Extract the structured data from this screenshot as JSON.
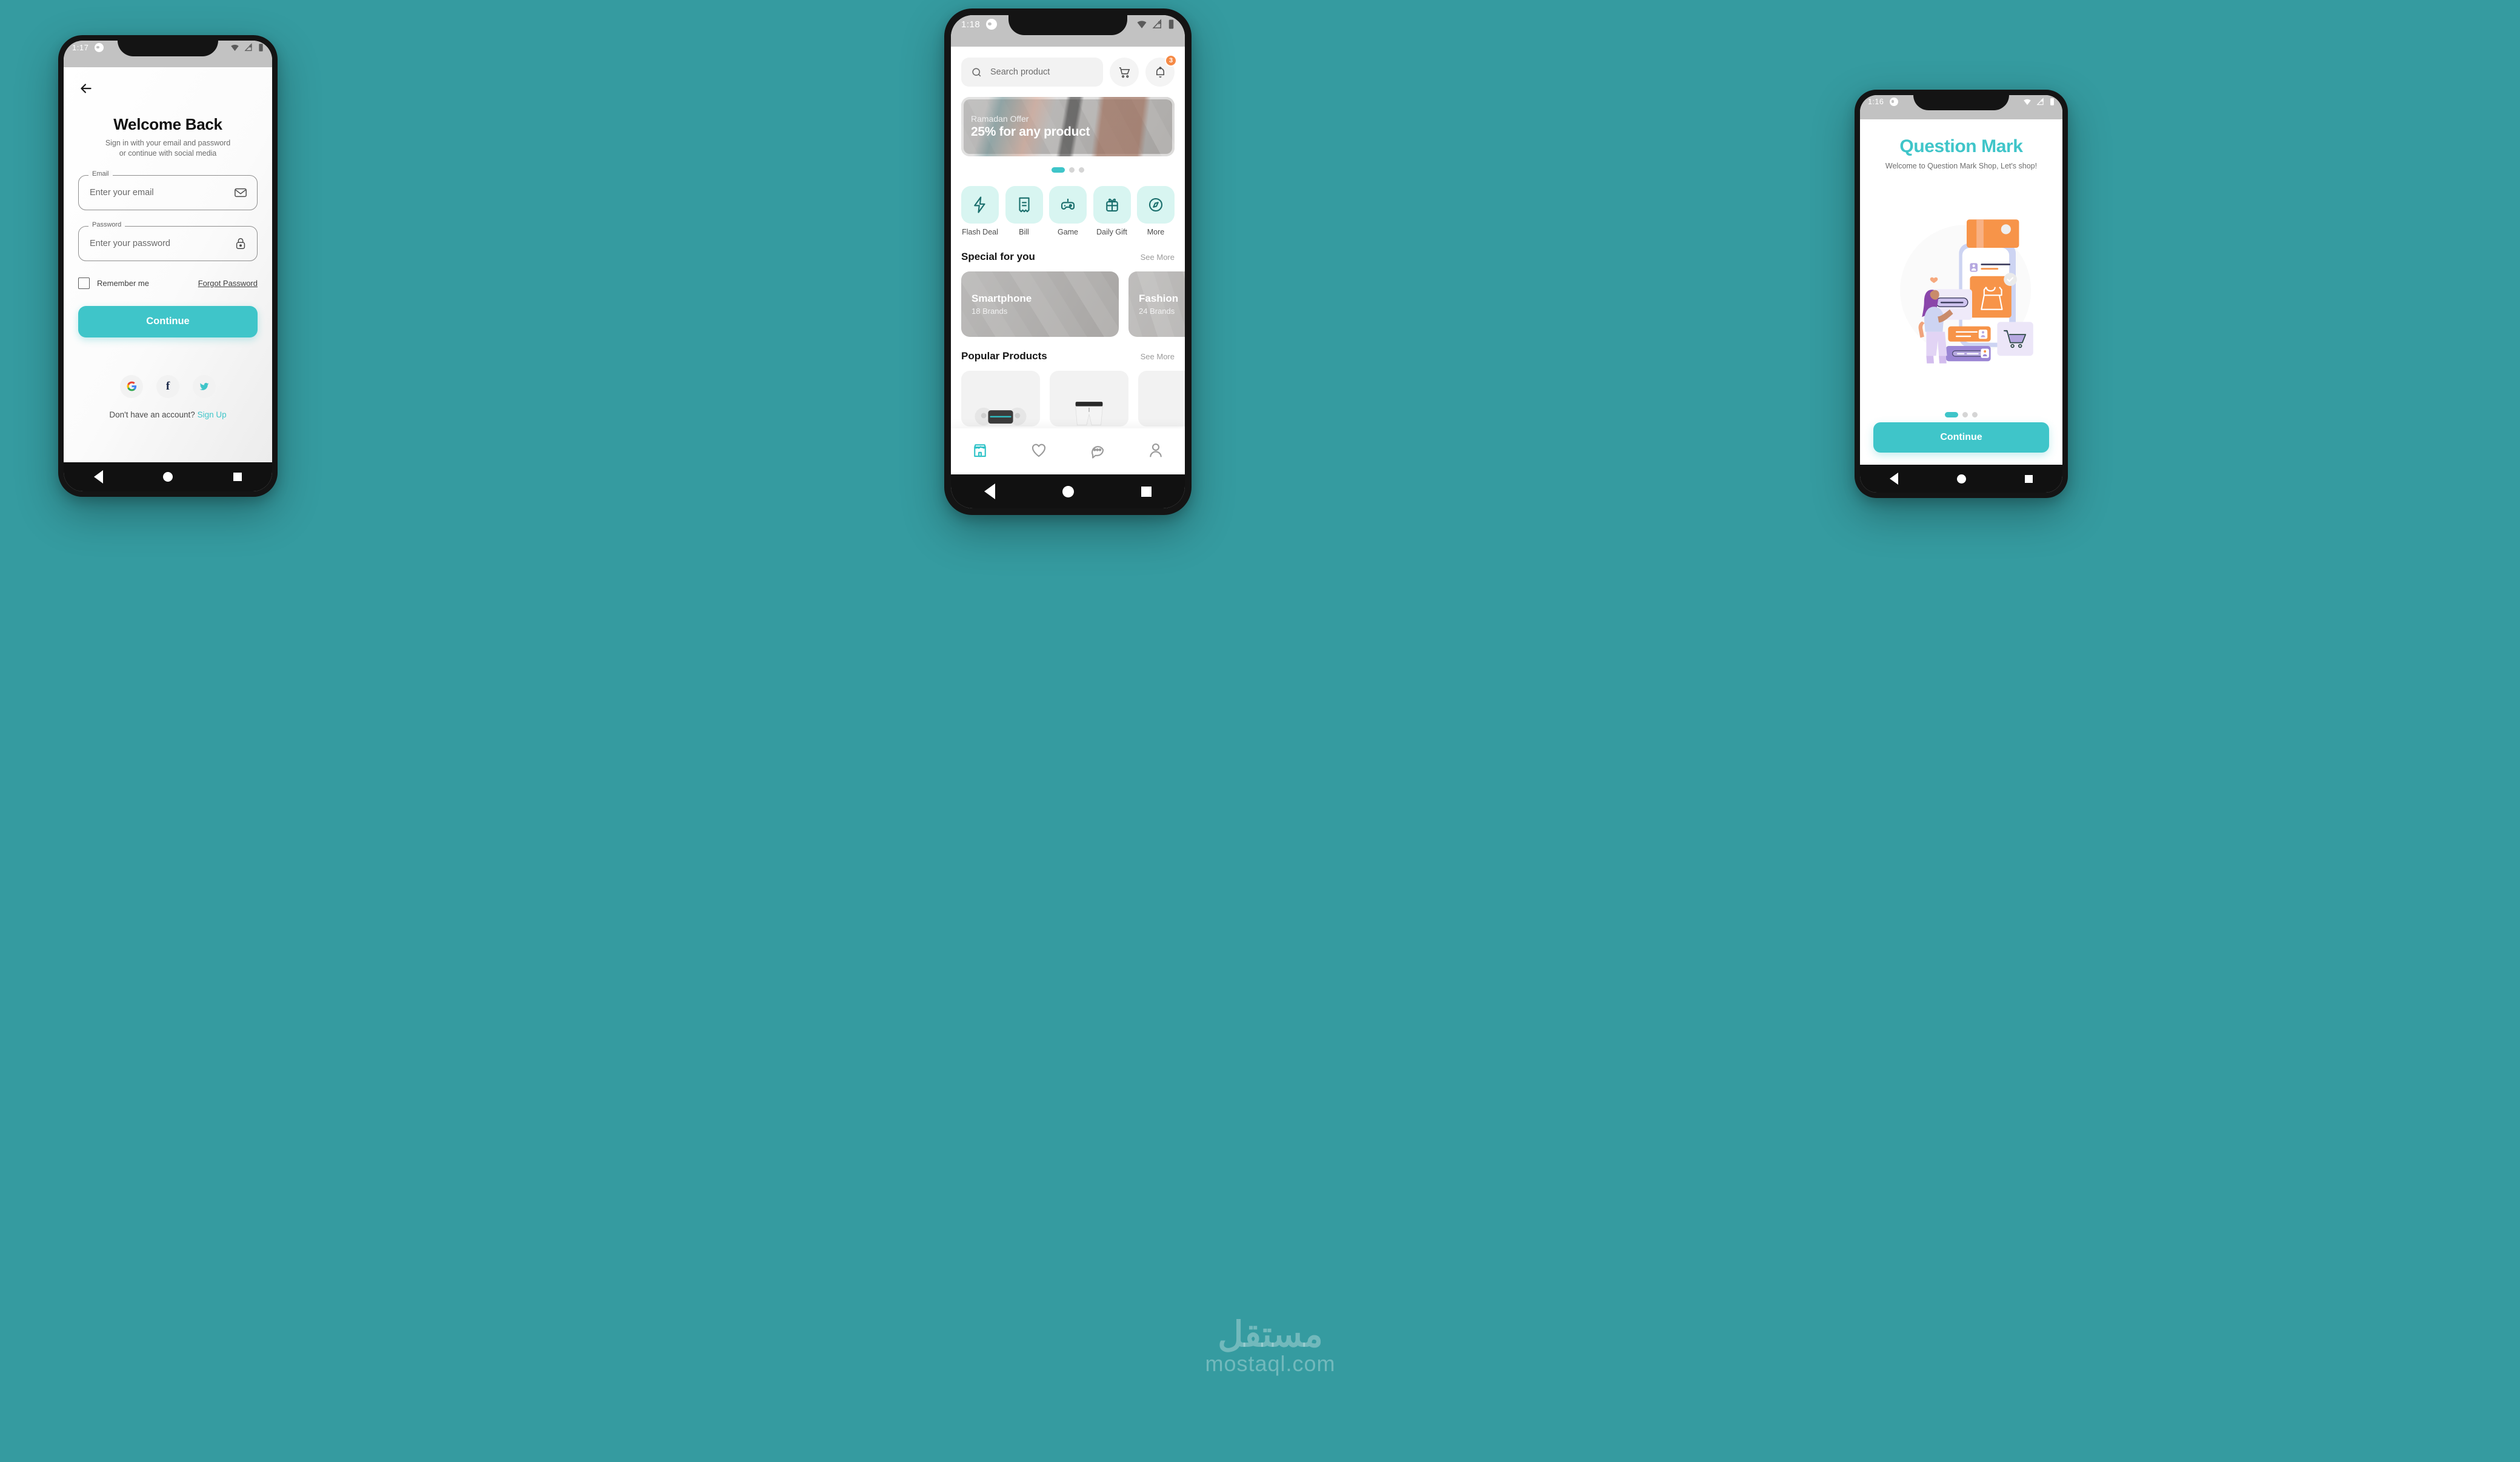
{
  "background_color": "#359ba0",
  "accent_color": "#3fc5c9",
  "badge_color": "#f58a46",
  "watermark": {
    "arabic": "مستقل",
    "latin": "mostaql.com"
  },
  "phone_login": {
    "status": {
      "time": "1:17",
      "wifi_icon": "wifi-icon",
      "signal_icon": "signal-off-icon",
      "battery_icon": "battery-icon"
    },
    "back_icon": "back-arrow-icon",
    "title": "Welcome Back",
    "subtitle_line1": "Sign in with your email and password",
    "subtitle_line2": "or continue with social media",
    "email_field": {
      "label": "Email",
      "placeholder": "Enter your email",
      "icon": "envelope-icon"
    },
    "password_field": {
      "label": "Password",
      "placeholder": "Enter your password",
      "icon": "lock-icon"
    },
    "remember_label": "Remember me",
    "forgot_label": "Forgot Password",
    "continue_label": "Continue",
    "social": [
      {
        "name": "google",
        "glyph": "G"
      },
      {
        "name": "facebook",
        "glyph": "f"
      },
      {
        "name": "twitter",
        "glyph": ""
      }
    ],
    "footer_text": "Don't have an account?",
    "footer_link": "Sign Up"
  },
  "phone_home": {
    "status": {
      "time": "1:18"
    },
    "search": {
      "placeholder": "Search product",
      "icon": "search-icon"
    },
    "cart_icon": "cart-icon",
    "bell_icon": "bell-icon",
    "notification_count": "3",
    "banner": {
      "eyebrow": "Ramadan Offer",
      "headline": "25% for any product",
      "dots_total": 3,
      "dots_active": 1
    },
    "categories": [
      {
        "label": "Flash Deal",
        "icon": "flash-icon"
      },
      {
        "label": "Bill",
        "icon": "receipt-icon"
      },
      {
        "label": "Game",
        "icon": "gamepad-icon"
      },
      {
        "label": "Daily Gift",
        "icon": "gift-icon"
      },
      {
        "label": "More",
        "icon": "compass-icon"
      }
    ],
    "special": {
      "title": "Special for you",
      "see_more": "See More",
      "cards": [
        {
          "title": "Smartphone",
          "subtitle": "18 Brands"
        },
        {
          "title": "Fashion",
          "subtitle": "24 Brands"
        }
      ]
    },
    "popular": {
      "title": "Popular Products",
      "see_more": "See More"
    },
    "tabs": [
      {
        "name": "shop",
        "icon": "store-icon",
        "active": true
      },
      {
        "name": "wishlist",
        "icon": "heart-icon",
        "active": false
      },
      {
        "name": "chat",
        "icon": "chat-icon",
        "active": false
      },
      {
        "name": "profile",
        "icon": "user-icon",
        "active": false
      }
    ]
  },
  "phone_onboarding": {
    "status": {
      "time": "1:16"
    },
    "title": "Question Mark",
    "subtitle": "Welcome to Question Mark Shop, Let's shop!",
    "illustration": "shopping-woman-illustration",
    "dots_total": 3,
    "dots_active": 1,
    "continue_label": "Continue"
  }
}
